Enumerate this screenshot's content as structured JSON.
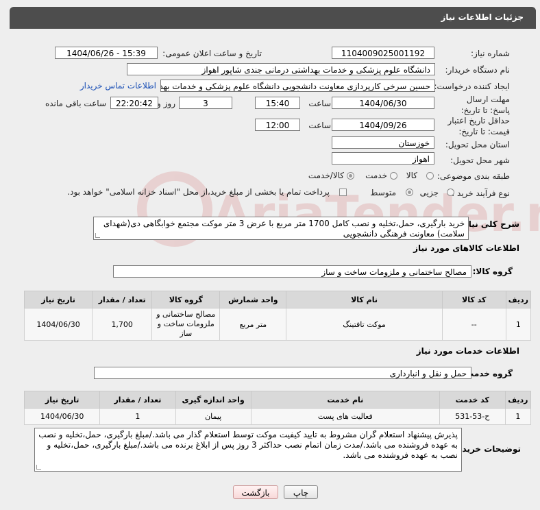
{
  "header": {
    "title": "جزئیات اطلاعات نیاز"
  },
  "fields": {
    "need_number_label": "شماره نیاز:",
    "need_number": "1104009025001192",
    "announce_label": "تاریخ و ساعت اعلان عمومی:",
    "announce_value": "1404/06/26 - 15:39",
    "buyer_org_label": "نام دستگاه خریدار:",
    "buyer_org": "دانشگاه علوم پزشکی و خدمات بهداشتی درمانی جندی شاپور اهواز",
    "creator_label": "ایجاد کننده درخواست:",
    "creator": "حسین سرخی کارپردازی معاونت دانشجویی دانشگاه علوم پزشکی و خدمات بهداشتی",
    "contact_link": "اطلاعات تماس خریدار",
    "reply_deadline_label": "مهلت ارسال پاسخ: تا تاریخ:",
    "reply_date": "1404/06/30",
    "time_label": "ساعت",
    "reply_time": "15:40",
    "days_value": "3",
    "days_label": "روز و",
    "remaining_time": "22:20:42",
    "remaining_label": "ساعت باقی مانده",
    "validity_label": "حداقل تاریخ اعتبار قیمت: تا تاریخ:",
    "validity_date": "1404/09/26",
    "validity_time": "12:00",
    "province_label": "استان محل تحویل:",
    "province": "خوزستان",
    "city_label": "شهر محل تحویل:",
    "city": "اهواز",
    "category_label": "طبقه بندی موضوعی:",
    "category_options": [
      "کالا",
      "خدمت",
      "کالا/خدمت"
    ],
    "process_label": "نوع فرآیند خرید :",
    "process_options": [
      "جزیی",
      "متوسط"
    ],
    "treasury_note": "پرداخت تمام یا بخشی از مبلغ خرید،از محل \"اسناد خزانه اسلامی\" خواهد بود.",
    "description_label": "شرح کلی نیاز:",
    "description": "خرید بارگیری، حمل،تخلیه و نصب کامل 1700  متر مربع با عرض 3 متر موکت مجتمع خوابگاهی دی(شهدای سلامت) معاونت فرهنگی دانشجویی"
  },
  "goods": {
    "section_title": "اطلاعات کالاهای مورد نیاز",
    "group_label": "گروه کالا:",
    "group_value": "مصالح ساختمانی و ملزومات ساخت و ساز",
    "columns": [
      "ردیف",
      "کد کالا",
      "نام کالا",
      "واحد شمارش",
      "گروه کالا",
      "تعداد / مقدار",
      "تاریخ نیاز"
    ],
    "rows": [
      {
        "row": "1",
        "code": "--",
        "name": "موکت تافتینگ",
        "unit": "متر مربع",
        "group": "مصالح ساختمانی و ملزومات ساخت و ساز",
        "qty": "1,700",
        "date": "1404/06/30"
      }
    ]
  },
  "services": {
    "section_title": "اطلاعات خدمات مورد نیاز",
    "group_label": "گروه خدمت:",
    "group_value": "حمل و نقل و انبارداری",
    "columns": [
      "ردیف",
      "کد خدمت",
      "نام خدمت",
      "واحد اندازه گیری",
      "تعداد / مقدار",
      "تاریخ نیاز"
    ],
    "rows": [
      {
        "row": "1",
        "code": "ح-53-531",
        "name": "فعالیت های پست",
        "unit": "پیمان",
        "qty": "1",
        "date": "1404/06/30"
      }
    ]
  },
  "buyer_notes": {
    "label": "توضیحات خریدار:",
    "text": "پذیرش پیشنهاد استعلام گران مشروط به تایید کیفیت موکت توسط استعلام گذار می باشد./مبلغ بارگیری، حمل،تخلیه و نصب به عهده فروشنده می باشد./مدت زمان اتمام نصب حداکثر 3 روز پس از ابلاغ برنده می باشد./مبلغ بارگیری، حمل،تخلیه و نصب به عهده فروشنده می باشد."
  },
  "buttons": {
    "print": "چاپ",
    "back": "بازگشت"
  },
  "colors": {
    "header_bg": "#4d4d4d",
    "link": "#1a4fb5",
    "table_header": "#d9d9d9"
  }
}
